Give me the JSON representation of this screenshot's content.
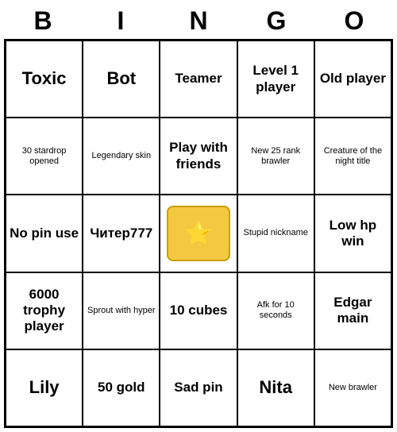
{
  "title": {
    "letters": [
      "B",
      "I",
      "N",
      "G",
      "O"
    ]
  },
  "cells": [
    {
      "text": "Toxic",
      "size": "large-text"
    },
    {
      "text": "Bot",
      "size": "large-text"
    },
    {
      "text": "Teamer",
      "size": "medium-text"
    },
    {
      "text": "Level 1 player",
      "size": "medium-text"
    },
    {
      "text": "Old player",
      "size": "medium-text"
    },
    {
      "text": "30 stardrop opened",
      "size": "small-text"
    },
    {
      "text": "Legendary skin",
      "size": "small-text"
    },
    {
      "text": "Play with friends",
      "size": "medium-text"
    },
    {
      "text": "New 25 rank brawler",
      "size": "small-text"
    },
    {
      "text": "Creature of the night title",
      "size": "small-text"
    },
    {
      "text": "No pin use",
      "size": "medium-text"
    },
    {
      "text": "Читер777",
      "size": "medium-text"
    },
    {
      "text": "IMAGE",
      "size": "",
      "isImage": true
    },
    {
      "text": "Stupid nickname",
      "size": "small-text"
    },
    {
      "text": "Low hp win",
      "size": "medium-text"
    },
    {
      "text": "6000 trophy player",
      "size": "medium-text"
    },
    {
      "text": "Sprout with hyper",
      "size": "small-text"
    },
    {
      "text": "10 cubes",
      "size": "medium-text"
    },
    {
      "text": "Afk for 10 seconds",
      "size": "small-text"
    },
    {
      "text": "Edgar main",
      "size": "medium-text"
    },
    {
      "text": "Lily",
      "size": "large-text"
    },
    {
      "text": "50 gold",
      "size": "medium-text"
    },
    {
      "text": "Sad pin",
      "size": "medium-text"
    },
    {
      "text": "Nita",
      "size": "large-text"
    },
    {
      "text": "New brawler",
      "size": "small-text"
    }
  ]
}
